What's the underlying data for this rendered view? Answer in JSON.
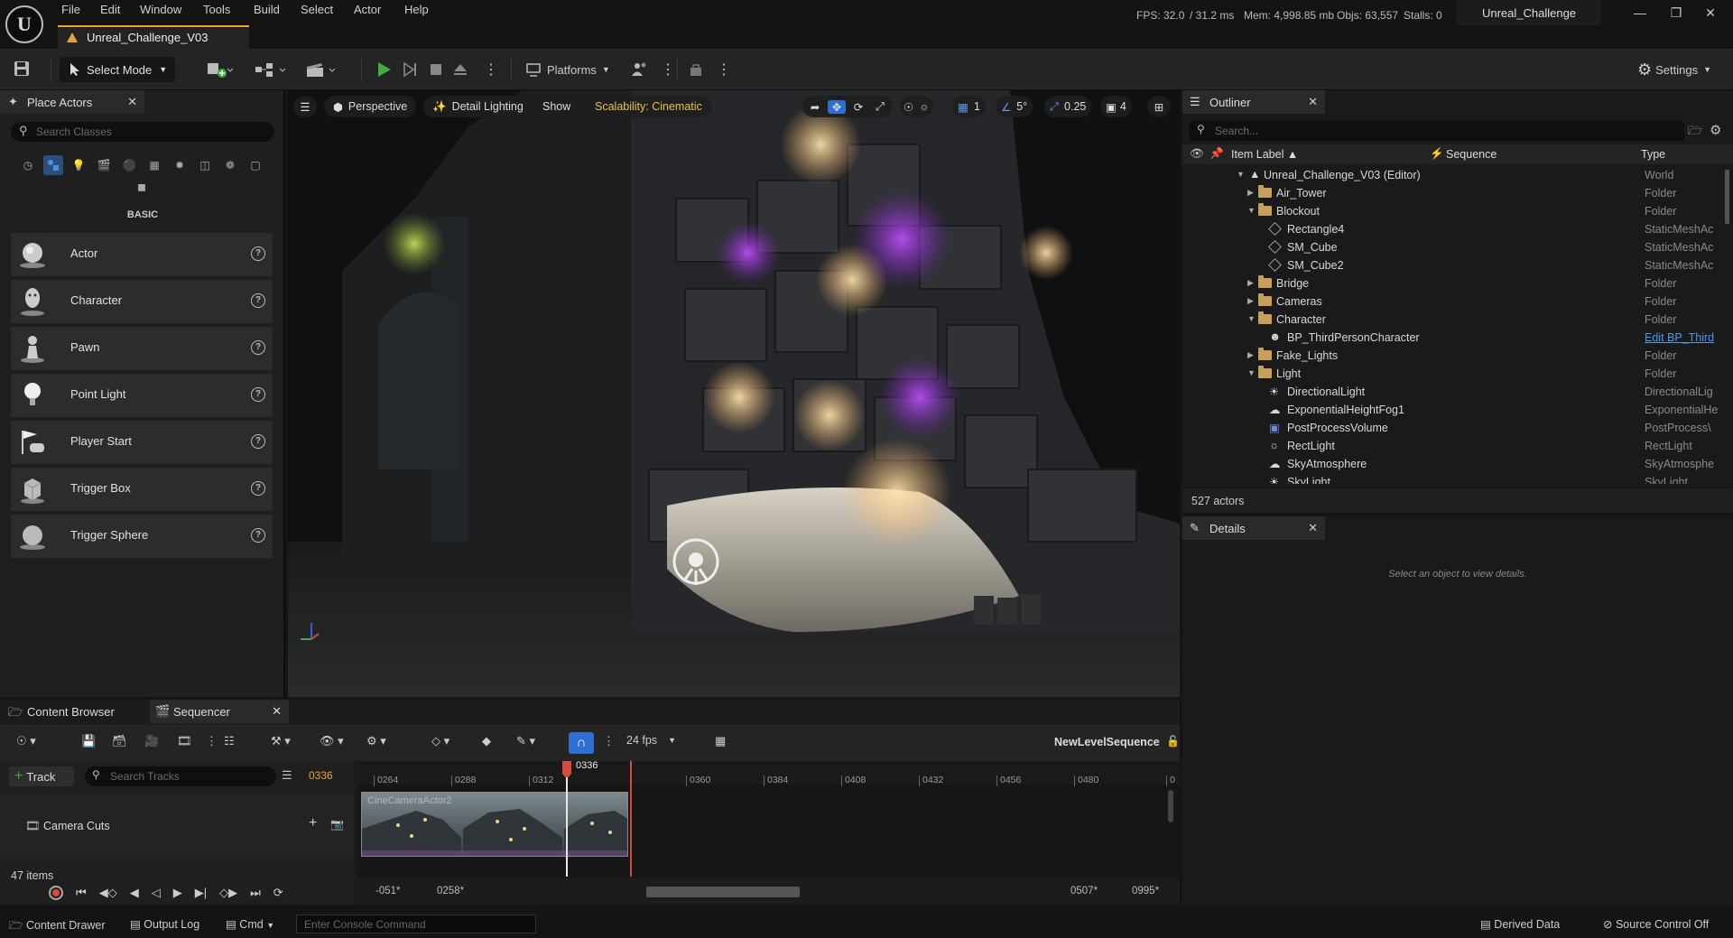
{
  "menubar": {
    "items": [
      "File",
      "Edit",
      "Window",
      "Tools",
      "Build",
      "Select",
      "Actor",
      "Help"
    ],
    "stats": {
      "fps": "FPS: 32.0",
      "ms": "/ 31.2 ms",
      "mem": "Mem: 4,998.85 mb",
      "objs": "Objs: 63,557",
      "stalls": "Stalls: 0"
    },
    "project_title": "Unreal_Challenge",
    "doc_tab": "Unreal_Challenge_V03"
  },
  "toolbar": {
    "select_mode": "Select Mode",
    "platforms": "Platforms",
    "settings": "Settings"
  },
  "place_actors": {
    "tab_label": "Place Actors",
    "search_placeholder": "Search Classes",
    "category_label": "BASIC",
    "items": [
      {
        "label": "Actor",
        "icon": "actor-sphere-icon"
      },
      {
        "label": "Character",
        "icon": "character-icon"
      },
      {
        "label": "Pawn",
        "icon": "pawn-icon"
      },
      {
        "label": "Point Light",
        "icon": "point-light-icon"
      },
      {
        "label": "Player Start",
        "icon": "player-start-icon"
      },
      {
        "label": "Trigger Box",
        "icon": "trigger-box-icon"
      },
      {
        "label": "Trigger Sphere",
        "icon": "trigger-sphere-icon"
      }
    ]
  },
  "viewport": {
    "perspective": "Perspective",
    "lighting": "Detail Lighting",
    "show": "Show",
    "scalability": "Scalability: Cinematic",
    "grid_size": "1",
    "rotation_snap": "5°",
    "scale_snap": "0.25",
    "camera_speed": "4"
  },
  "outliner": {
    "tab_label": "Outliner",
    "search_placeholder": "Search...",
    "col_label": "Item Label",
    "col_sequence": "Sequence",
    "col_type": "Type",
    "rows": [
      {
        "name": "Unreal_Challenge_V03 (Editor)",
        "type": "World"
      },
      {
        "name": "Air_Tower",
        "type": "Folder"
      },
      {
        "name": "Blockout",
        "type": "Folder"
      },
      {
        "name": "Rectangle4",
        "type": "StaticMeshAc"
      },
      {
        "name": "SM_Cube",
        "type": "StaticMeshAc"
      },
      {
        "name": "SM_Cube2",
        "type": "StaticMeshAc"
      },
      {
        "name": "Bridge",
        "type": "Folder"
      },
      {
        "name": "Cameras",
        "type": "Folder"
      },
      {
        "name": "Character",
        "type": "Folder"
      },
      {
        "name": "BP_ThirdPersonCharacter",
        "type": "Edit BP_Third"
      },
      {
        "name": "Fake_Lights",
        "type": "Folder"
      },
      {
        "name": "Light",
        "type": "Folder"
      },
      {
        "name": "DirectionalLight",
        "type": "DirectionalLig"
      },
      {
        "name": "ExponentialHeightFog1",
        "type": "ExponentialHe"
      },
      {
        "name": "PostProcessVolume",
        "type": "PostProcess\\"
      },
      {
        "name": "RectLight",
        "type": "RectLight"
      },
      {
        "name": "SkyAtmosphere",
        "type": "SkyAtmosphe"
      },
      {
        "name": "SkyLight",
        "type": "SkyLight"
      }
    ],
    "actor_count": "527 actors"
  },
  "details": {
    "tab_label": "Details",
    "empty_message": "Select an object to view details."
  },
  "sequencer": {
    "content_browser_tab": "Content Browser",
    "sequencer_tab": "Sequencer",
    "fps": "24 fps",
    "sequence_name": "NewLevelSequence",
    "add_track": "Track",
    "search_tracks_placeholder": "Search Tracks",
    "current_frame": "0336",
    "playhead_label": "0336",
    "track_name": "Camera Cuts",
    "clip_label": "CineCameraActor2",
    "items_count": "47 items",
    "ticks": [
      "0264",
      "0288",
      "0312",
      "0360",
      "0384",
      "0408",
      "0432",
      "0456",
      "0480",
      "0"
    ],
    "range_start": "-051*",
    "view_start": "0258*",
    "view_end": "0507*",
    "range_end": "0995*"
  },
  "statusbar": {
    "content_drawer": "Content Drawer",
    "output_log": "Output Log",
    "cmd": "Cmd",
    "console_placeholder": "Enter Console Command",
    "derived_data": "Derived Data",
    "source_control": "Source Control Off"
  },
  "colors": {
    "accent": "#e8a23a",
    "play_green": "#3fae3f",
    "select_blue": "#2f6fd4",
    "playhead": "#d84a3a",
    "scalability_text": "#e8c24a"
  }
}
